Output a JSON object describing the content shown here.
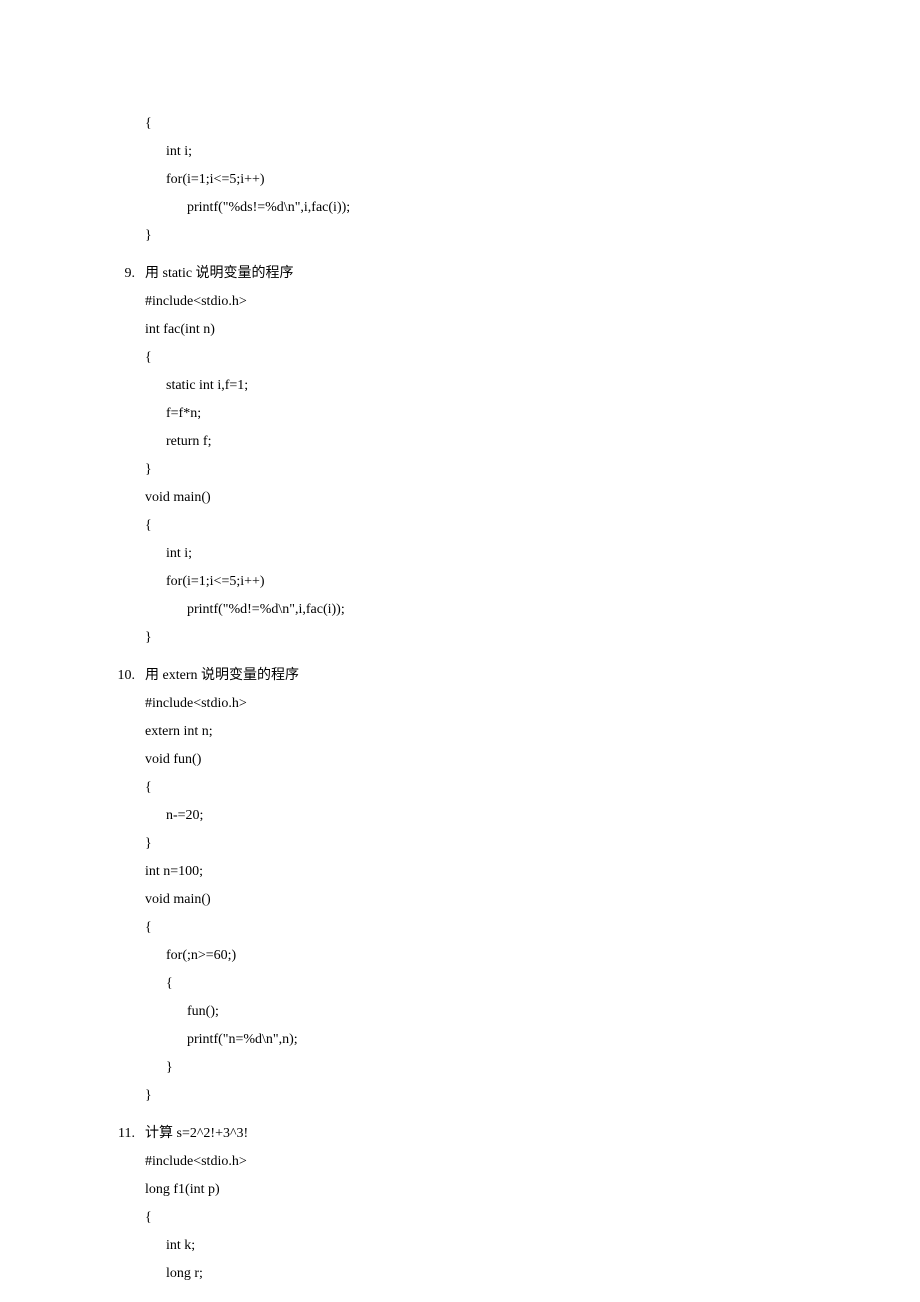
{
  "items": [
    {
      "marker": "",
      "title": "",
      "lines": [
        "{",
        "      int i;",
        "      for(i=1;i<=5;i++)",
        "            printf(\"%ds!=%d\\n\",i,fac(i));",
        "}"
      ]
    },
    {
      "marker": "9.",
      "title": "用 static 说明变量的程序",
      "lines": [
        "#include<stdio.h>",
        "int fac(int n)",
        "{",
        "      static int i,f=1;",
        "      f=f*n;",
        "      return f;",
        "}",
        "void main()",
        "{",
        "      int i;",
        "      for(i=1;i<=5;i++)",
        "            printf(\"%d!=%d\\n\",i,fac(i));",
        "}"
      ]
    },
    {
      "marker": "10.",
      "title": "用 extern 说明变量的程序",
      "lines": [
        "#include<stdio.h>",
        "extern int n;",
        "void fun()",
        "{",
        "      n-=20;",
        "}",
        "int n=100;",
        "void main()",
        "{",
        "      for(;n>=60;)",
        "      {",
        "            fun();",
        "            printf(\"n=%d\\n\",n);",
        "      }",
        "}"
      ]
    },
    {
      "marker": "11.",
      "title": "计算 s=2^2!+3^3!",
      "lines": [
        "#include<stdio.h>",
        "long f1(int p)",
        "{",
        "      int k;",
        "      long r;"
      ]
    }
  ]
}
